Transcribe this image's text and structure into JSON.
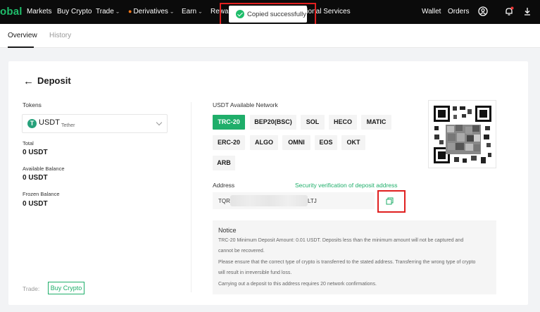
{
  "nav": {
    "logo": "obal",
    "items": [
      "Markets",
      "Buy Crypto",
      "Trade",
      "Derivatives",
      "Earn",
      "Rewar",
      "utional Services"
    ],
    "right": [
      "Wallet",
      "Orders"
    ]
  },
  "toast": {
    "message": "Copied successfully"
  },
  "tabs": [
    "Overview",
    "History"
  ],
  "page": {
    "title": "Deposit"
  },
  "left": {
    "tokens_label": "Tokens",
    "token": {
      "symbol": "USDT",
      "name": "Tether"
    },
    "balances": [
      {
        "label": "Total",
        "value": "0 USDT"
      },
      {
        "label": "Available Balance",
        "value": "0 USDT"
      },
      {
        "label": "Frozen Balance",
        "value": "0 USDT"
      }
    ],
    "trade_label": "Trade:",
    "buy_crypto": "Buy Crypto"
  },
  "network": {
    "label": "USDT Available Network",
    "options": [
      "TRC-20",
      "BEP20(BSC)",
      "SOL",
      "HECO",
      "MATIC",
      "ERC-20",
      "ALGO",
      "OMNI",
      "EOS",
      "OKT",
      "ARB"
    ],
    "selected": "TRC-20"
  },
  "address": {
    "label": "Address",
    "security_link": "Security verification of deposit address",
    "prefix": "TQR",
    "suffix": "LTJ"
  },
  "notice": {
    "title": "Notice",
    "lines": [
      "TRC-20 Minimum Deposit Amount: 0.01 USDT. Deposits less than the minimum amount will not be captured and",
      "cannot be recovered.",
      "Please ensure that the correct type of crypto is transferred to the stated address. Transferring the wrong type of crypto",
      "will result in irreversible fund loss.",
      "Carrying out a deposit to this address requires 20 network confirmations."
    ]
  },
  "colors": {
    "accent": "#1fae6a",
    "highlight": "#e02020",
    "nav_bg": "#0b0b0b"
  }
}
